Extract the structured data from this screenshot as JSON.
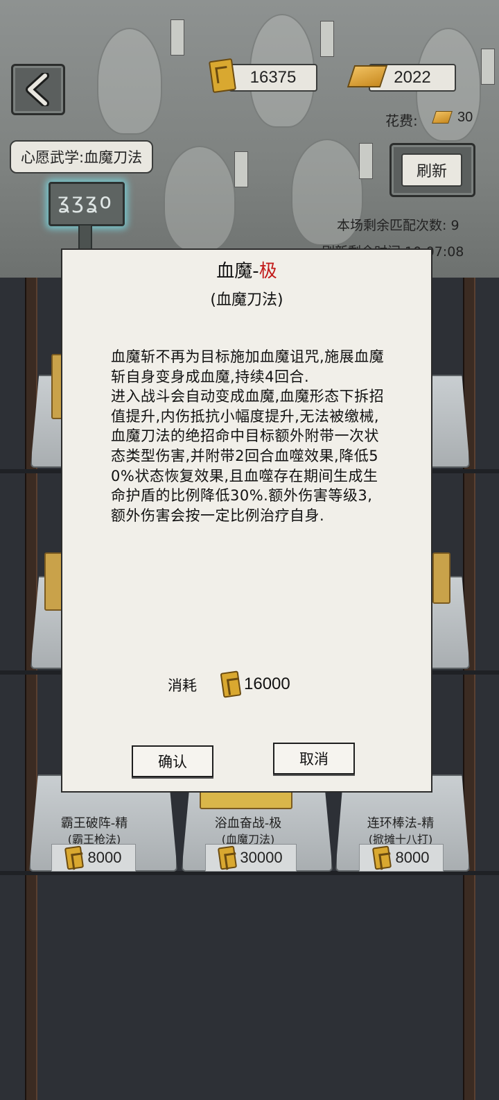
{
  "header": {
    "scroll_currency": "16375",
    "gold_currency": "2022",
    "cost_label": "花费:",
    "cost_value": "30",
    "wish_label": "心愿武学:血魔刀法",
    "refresh_button": "刷新",
    "remaining_matches": "本场剩余匹配次数:  9",
    "refresh_time_partial": "刷新剩余时间    10:07:08"
  },
  "shelf_cards": [
    {
      "name": "霸王破阵-精",
      "school": "(霸王枪法)",
      "price": "8000"
    },
    {
      "name": "浴血奋战-极",
      "school": "(血魔刀法)",
      "price": "30000"
    },
    {
      "name": "连环棒法-精",
      "school": "(掀摊十八打)",
      "price": "8000"
    }
  ],
  "modal": {
    "title_main": "血魔-",
    "title_grade": "极",
    "subtitle": "(血魔刀法)",
    "description": "血魔斩不再为目标施加血魔诅咒,施展血魔斩自身变身成血魔,持续4回合.\n进入战斗会自动变成血魔,血魔形态下拆招值提升,内伤抵抗小幅度提升,无法被缴械,血魔刀法的绝招命中目标额外附带一次状态类型伤害,并附带2回合血噬效果,降低50%状态恢复效果,且血噬存在期间生成生命护盾的比例降低30%.额外伤害等级3,额外伤害会按一定比例治疗自身.",
    "consume_label": "消耗",
    "consume_value": "16000",
    "confirm_button": "确认",
    "cancel_button": "取消"
  },
  "colors": {
    "grade_red": "#c21a1a",
    "glow_cyan": "#78e6f0",
    "gold": "#d9a830"
  }
}
